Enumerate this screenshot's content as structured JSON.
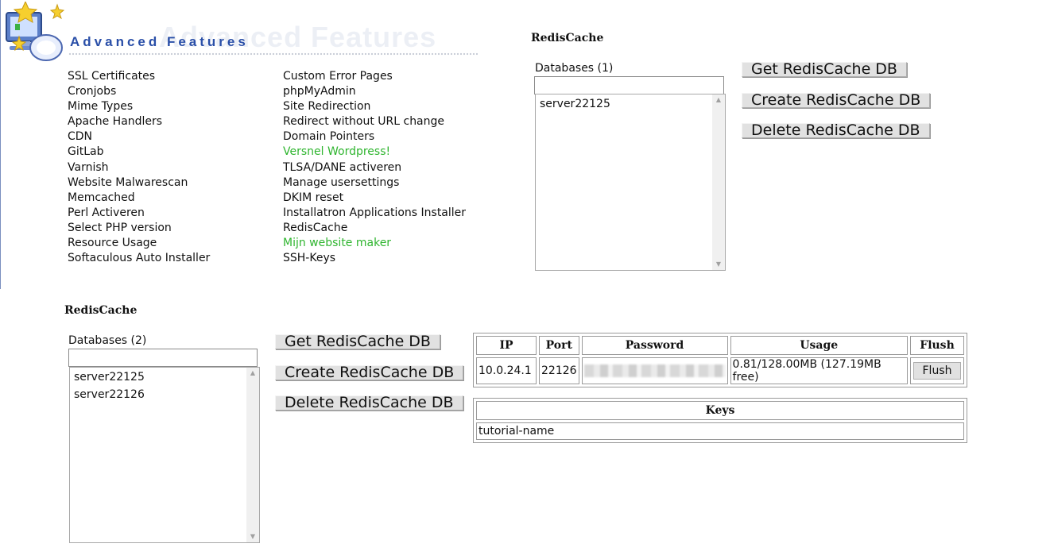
{
  "header": {
    "title": "Advanced Features",
    "logo_icon": "advanced-features-logo-icon"
  },
  "features": {
    "left": [
      {
        "label": "SSL Certificates",
        "green": false
      },
      {
        "label": "Cronjobs",
        "green": false
      },
      {
        "label": "Mime Types",
        "green": false
      },
      {
        "label": "Apache Handlers",
        "green": false
      },
      {
        "label": "CDN",
        "green": false
      },
      {
        "label": "GitLab",
        "green": false
      },
      {
        "label": "Varnish",
        "green": false
      },
      {
        "label": "Website Malwarescan",
        "green": false
      },
      {
        "label": "Memcached",
        "green": false
      },
      {
        "label": "Perl Activeren",
        "green": false
      },
      {
        "label": "Select PHP version",
        "green": false
      },
      {
        "label": "Resource Usage",
        "green": false
      },
      {
        "label": "Softaculous Auto Installer",
        "green": false
      }
    ],
    "right": [
      {
        "label": "Custom Error Pages",
        "green": false
      },
      {
        "label": "phpMyAdmin",
        "green": false
      },
      {
        "label": "Site Redirection",
        "green": false
      },
      {
        "label": "Redirect without URL change",
        "green": false
      },
      {
        "label": "Domain Pointers",
        "green": false
      },
      {
        "label": "Versnel Wordpress!",
        "green": true
      },
      {
        "label": "TLSA/DANE activeren",
        "green": false
      },
      {
        "label": "Manage usersettings",
        "green": false
      },
      {
        "label": "DKIM reset",
        "green": false
      },
      {
        "label": "Installatron Applications Installer",
        "green": false
      },
      {
        "label": "RedisCache",
        "green": false
      },
      {
        "label": "Mijn website maker",
        "green": true
      },
      {
        "label": "SSH-Keys",
        "green": false
      }
    ],
    "green_color": "#2fb52f"
  },
  "redis_top": {
    "title": "RedisCache",
    "databases_label": "Databases (1)",
    "filter_value": "",
    "databases": [
      "server22125"
    ],
    "buttons": {
      "get": "Get RedisCache DB",
      "create": "Create RedisCache DB",
      "delete": "Delete RedisCache DB"
    }
  },
  "redis_bottom": {
    "title": "RedisCache",
    "databases_label": "Databases (2)",
    "filter_value": "",
    "databases": [
      "server22125",
      "server22126"
    ],
    "buttons": {
      "get": "Get RedisCache DB",
      "create": "Create RedisCache DB",
      "delete": "Delete RedisCache DB"
    },
    "info_table": {
      "headers": {
        "ip": "IP",
        "port": "Port",
        "password": "Password",
        "usage": "Usage",
        "flush": "Flush"
      },
      "row": {
        "ip": "10.0.24.1",
        "port": "22126",
        "usage": "0.81/128.00MB (127.19MB free)",
        "flush_button": "Flush"
      }
    },
    "keys_table": {
      "header": "Keys",
      "keys": [
        "tutorial-name"
      ]
    }
  }
}
